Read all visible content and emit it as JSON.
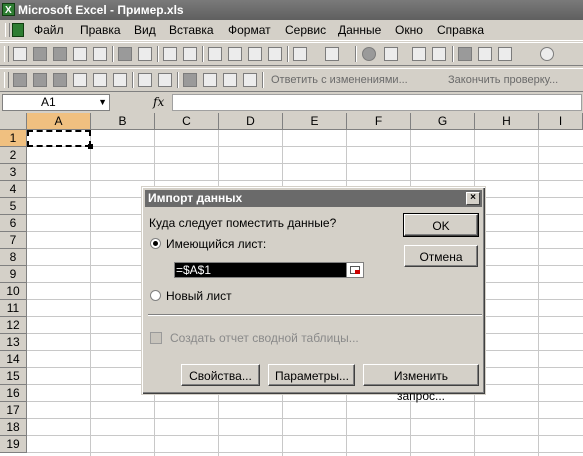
{
  "window": {
    "title": "Microsoft Excel - Пример.xls"
  },
  "menu": [
    "Файл",
    "Правка",
    "Вид",
    "Вставка",
    "Формат",
    "Сервис",
    "Данные",
    "Окно",
    "Справка"
  ],
  "toolbar2": {
    "reply_label": "Ответить с изменениями...",
    "end_review_label": "Закончить проверку..."
  },
  "formula_bar": {
    "name_box": "A1",
    "fx_label": "fx",
    "formula": ""
  },
  "columns": [
    "A",
    "B",
    "C",
    "D",
    "E",
    "F",
    "G",
    "H",
    "I"
  ],
  "rows": [
    "1",
    "2",
    "3",
    "4",
    "5",
    "6",
    "7",
    "8",
    "9",
    "10",
    "11",
    "12",
    "13",
    "14",
    "15",
    "16",
    "17",
    "18",
    "19"
  ],
  "dialog": {
    "title": "Импорт данных",
    "question": "Куда следует поместить данные?",
    "existing_sheet_label": "Имеющийся лист:",
    "reference": "=$A$1",
    "new_sheet_label": "Новый лист",
    "pivot_label": "Создать отчет сводной таблицы...",
    "ok_label": "OK",
    "cancel_label": "Отмена",
    "properties_label": "Свойства...",
    "parameters_label": "Параметры...",
    "edit_query_label": "Изменить запрос...",
    "close_label": "×"
  }
}
